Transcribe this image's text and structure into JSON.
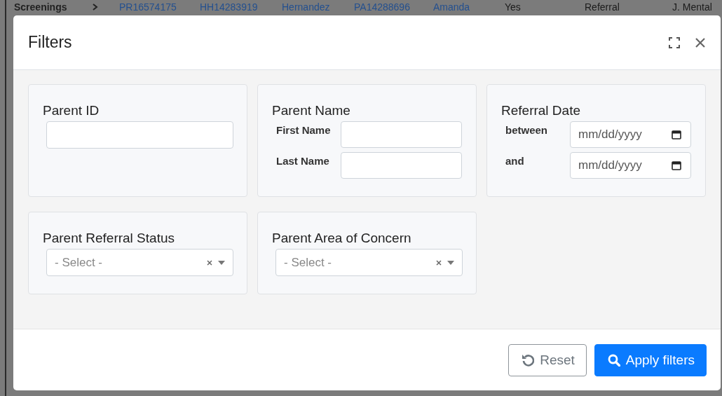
{
  "backdrop_row": {
    "section": "Screenings",
    "cells": [
      {
        "kind": "link",
        "text": "PR16574175"
      },
      {
        "kind": "link",
        "text": "HH14283919"
      },
      {
        "kind": "link",
        "text": "Hernandez"
      },
      {
        "kind": "link",
        "text": "PA14288696"
      },
      {
        "kind": "link",
        "text": "Amanda"
      },
      {
        "kind": "text",
        "text": "Yes"
      },
      {
        "kind": "text",
        "text": "Referral"
      },
      {
        "kind": "text",
        "text": "J. Mental"
      }
    ]
  },
  "dialog": {
    "title": "Filters"
  },
  "filters": [
    {
      "kind": "text",
      "label": "Parent ID"
    },
    {
      "kind": "pair",
      "label": "Parent Name",
      "fields": [
        {
          "label": "First Name"
        },
        {
          "label": "Last Name"
        }
      ]
    },
    {
      "kind": "date_range",
      "label": "Referral Date",
      "fields": [
        {
          "label": "between",
          "placeholder": "mm/dd/yyyy"
        },
        {
          "label": "and",
          "placeholder": "mm/dd/yyyy"
        }
      ]
    },
    {
      "kind": "select",
      "label": "Parent Referral Status",
      "placeholder": "- Select -"
    },
    {
      "kind": "select",
      "label": "Parent Area of Concern",
      "placeholder": "- Select -"
    }
  ],
  "buttons": [
    {
      "kind": "secondary",
      "label": "Reset"
    },
    {
      "kind": "primary",
      "label": "Apply filters"
    }
  ]
}
